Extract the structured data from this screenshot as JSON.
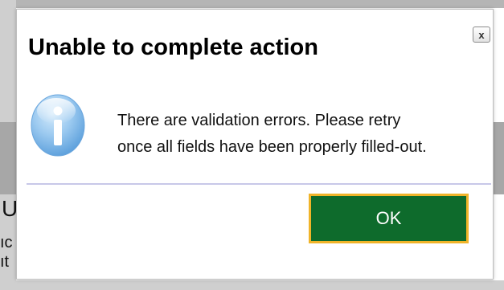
{
  "dialog": {
    "title": "Unable to complete action",
    "close_label": "x",
    "icon": "info-icon",
    "message_line1": "There are validation errors. Please retry",
    "message_line2": "once all fields have been properly filled-out.",
    "ok_label": "OK"
  },
  "background": {
    "partial_heading": "U",
    "partial_line1": "ıc",
    "partial_line2": "ıt"
  },
  "colors": {
    "ok_button_bg": "#0e6b2c",
    "ok_button_border": "#f0b429",
    "divider": "#c8c8e8"
  }
}
